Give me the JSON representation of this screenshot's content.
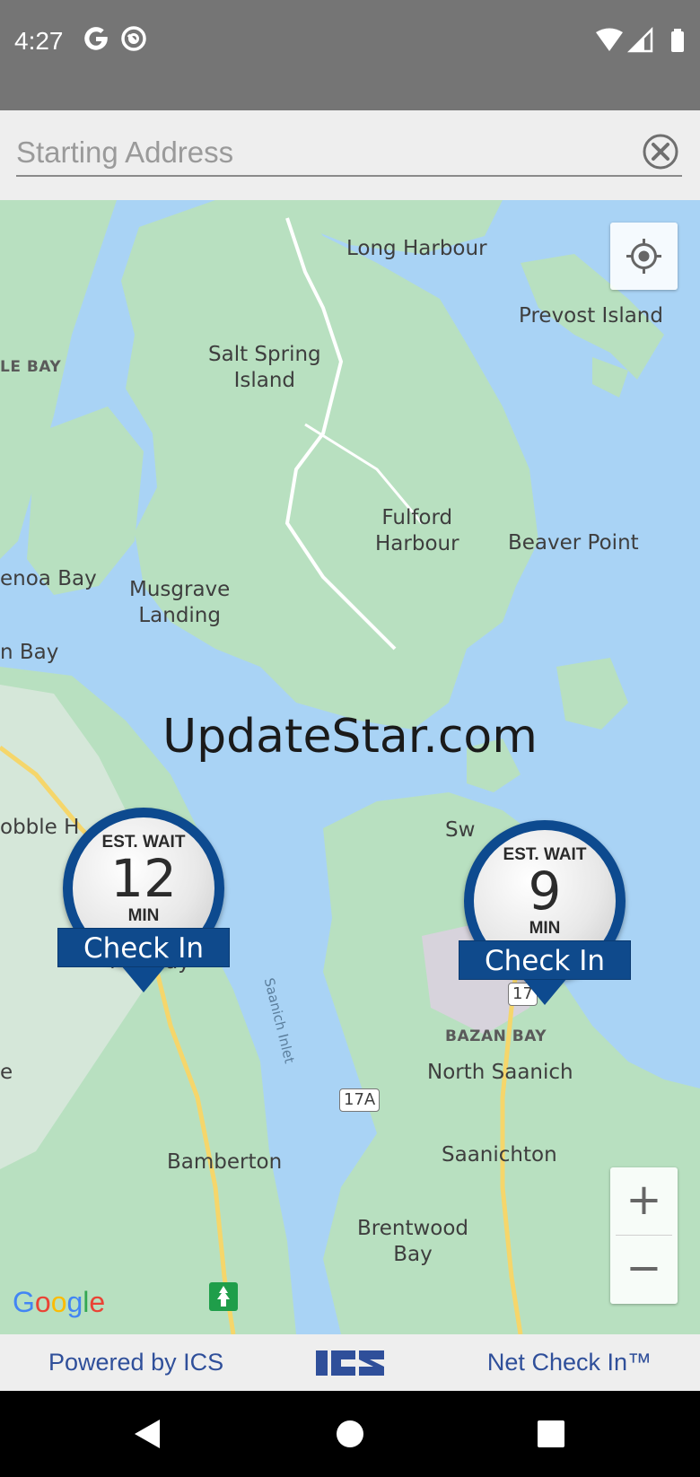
{
  "status_bar": {
    "time": "4:27",
    "left_icons": [
      "google-g-icon",
      "assistant-icon"
    ],
    "right_icons": [
      "wifi-icon",
      "cellular-signal-icon",
      "battery-icon"
    ]
  },
  "search": {
    "placeholder": "Starting Address",
    "value": ""
  },
  "map": {
    "labels": {
      "long_harbour": "Long Harbour",
      "prevost_island": "Prevost Island",
      "salt_spring": "Salt Spring\nIsland",
      "le_bay": "LE BAY",
      "fulford": "Fulford\nHarbour",
      "beaver_point": "Beaver Point",
      "genoa_bay": "enoa Bay",
      "musgrave": "Musgrave\nLanding",
      "n_bay": "n Bay",
      "cobble_hill": "obble H",
      "mill_bay": "Mill Bay",
      "saanich_inlet": "Saanich Inlet",
      "sw": "Sw",
      "hwy_17": "17",
      "bazan_bay": "BAZAN BAY",
      "north_saanich": "North Saanich",
      "hwy_17a": "17A",
      "e_edge": "e",
      "saanichton": "Saanichton",
      "bamberton": "Bamberton",
      "brentwood": "Brentwood\nBay"
    },
    "watermark": "UpdateStar.com",
    "google_logo": "Google",
    "zoom_in": "+",
    "zoom_out": "−"
  },
  "pins": [
    {
      "est_label": "EST. WAIT",
      "wait": "12",
      "unit": "MIN",
      "checkin": "Check In"
    },
    {
      "est_label": "EST. WAIT",
      "wait": "9",
      "unit": "MIN",
      "checkin": "Check In"
    }
  ],
  "footer": {
    "powered": "Powered by ICS",
    "logo": "ICS",
    "net_check_in": "Net Check In™"
  },
  "colors": {
    "water": "#a9d3f5",
    "land": "#b8e0c0",
    "urban": "#ececec",
    "pin_blue": "#0d4a8f",
    "footer_text": "#2f4f9a"
  }
}
